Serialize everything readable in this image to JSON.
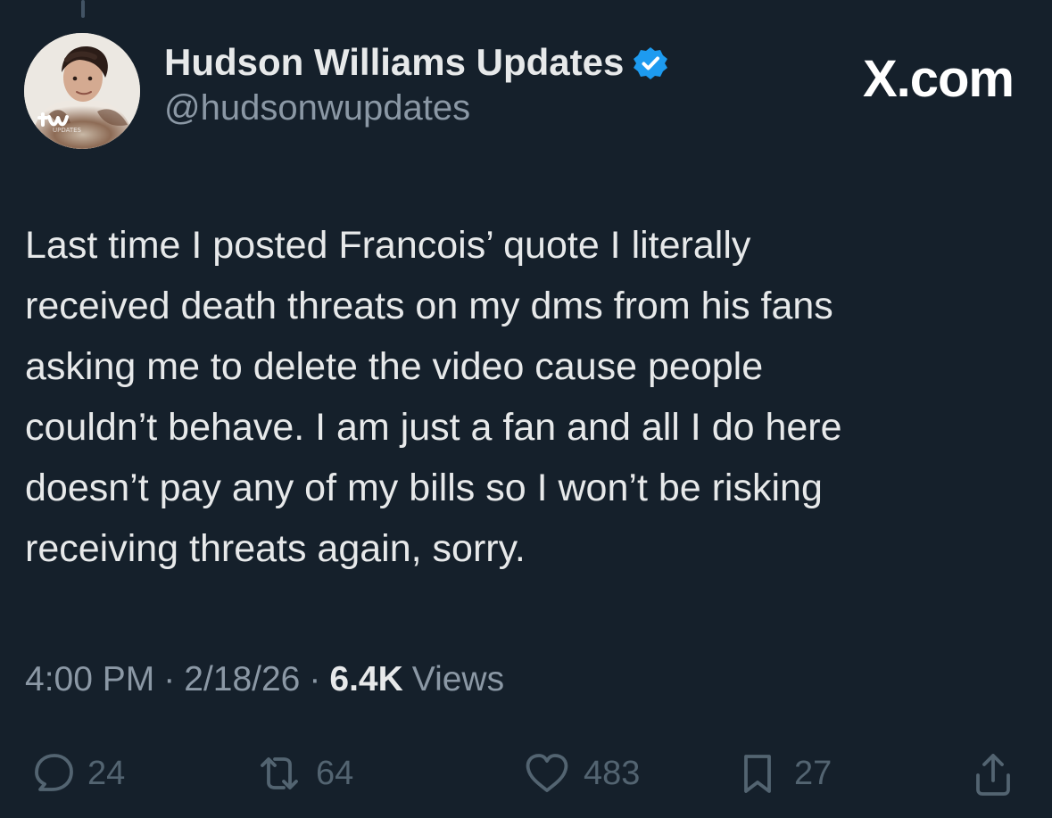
{
  "account": {
    "display_name": "Hudson Williams Updates",
    "handle": "@hudsonwupdates",
    "avatar_mark": "HW"
  },
  "watermark": "X.com",
  "post": {
    "text": "Last time I posted Francois’ quote I literally\nreceived death threats on my dms from his fans\nasking me to delete the video cause people\ncouldn’t behave. I am just a fan and all I do here\ndoesn’t pay any of my bills so I won’t be risking\nreceiving threats again, sorry."
  },
  "meta": {
    "time": "4:00 PM",
    "separator": "·",
    "date": "2/18/26",
    "views_count": "6.4K",
    "views_label": "Views"
  },
  "actions": {
    "reply_count": "24",
    "repost_count": "64",
    "like_count": "483",
    "bookmark_count": "27"
  },
  "icons": {
    "verified": "verified-badge-icon",
    "reply": "comment-icon",
    "repost": "repost-icon",
    "like": "heart-icon",
    "bookmark": "bookmark-icon",
    "share": "share-icon"
  },
  "colors": {
    "background": "#15202b",
    "text": "#e7e9ea",
    "muted": "#8b98a5",
    "action": "#536471",
    "verified": "#1d9bf0"
  }
}
